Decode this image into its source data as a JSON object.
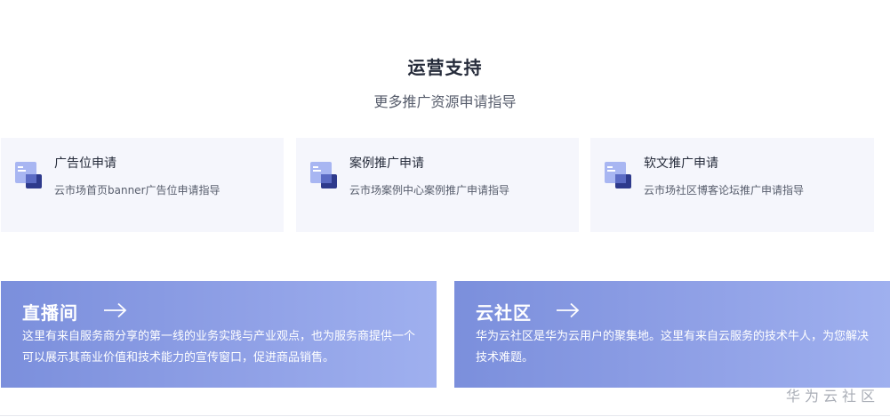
{
  "section": {
    "title": "运营支持",
    "subtitle": "更多推广资源申请指导"
  },
  "cards": [
    {
      "title": "广告位申请",
      "description": "云市场首页banner广告位申请指导",
      "icon": "document-icon"
    },
    {
      "title": "案例推广申请",
      "description": "云市场案例中心案例推广申请指导",
      "icon": "document-icon"
    },
    {
      "title": "软文推广申请",
      "description": "云市场社区博客论坛推广申请指导",
      "icon": "document-icon"
    }
  ],
  "banners": [
    {
      "title": "直播间",
      "description": "这里有来自服务商分享的第一线的业务实践与产业观点，也为服务商提供一个可以展示其商业价值和技术能力的宣传窗口，促进商品销售。",
      "icon": "arrow-right-icon"
    },
    {
      "title": "云社区",
      "description": "华为云社区是华为云用户的聚集地。这里有来自云服务的技术牛人，为您解决技术难题。",
      "icon": "arrow-right-icon"
    }
  ],
  "watermark": "华为云社区",
  "colors": {
    "card_background": "#f5f6fc",
    "banner_gradient_start": "#7b8fdc",
    "banner_gradient_end": "#9fb0ef",
    "icon_light": "#a8b6f2",
    "icon_dark": "#2e3a8c"
  }
}
